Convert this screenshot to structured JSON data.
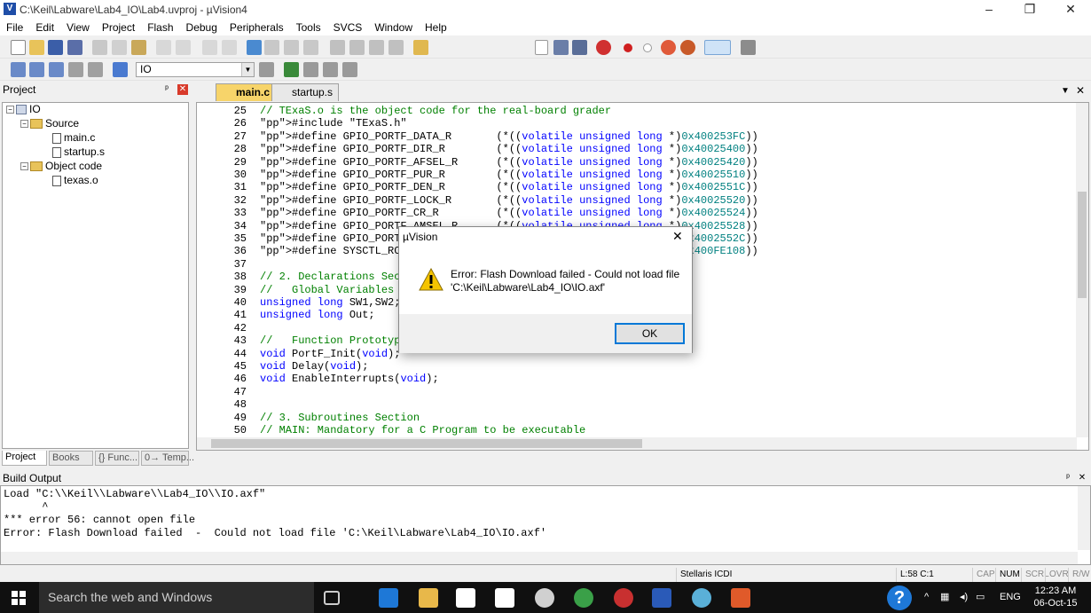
{
  "window": {
    "title": "C:\\Keil\\Labware\\Lab4_IO\\Lab4.uvproj - µVision4",
    "app_icon": "V",
    "minimize": "–",
    "restore": "❐",
    "close": "✕"
  },
  "menu": [
    "File",
    "Edit",
    "View",
    "Project",
    "Flash",
    "Debug",
    "Peripherals",
    "Tools",
    "SVCS",
    "Window",
    "Help"
  ],
  "toolbar2": {
    "target": "IO"
  },
  "project_panel": {
    "title": "Project",
    "pin": "ᵖ",
    "close": "✕",
    "tree": {
      "root": "IO",
      "groups": [
        {
          "name": "Source",
          "files": [
            "main.c",
            "startup.s"
          ]
        },
        {
          "name": "Object code",
          "files": [
            "texas.o"
          ]
        }
      ]
    },
    "tabs": [
      "Project",
      "Books",
      "{} Func...",
      "0→ Temp..."
    ]
  },
  "editor": {
    "tabs": [
      "main.c",
      "startup.s"
    ],
    "active_tab": "main.c",
    "lines": [
      {
        "n": "25",
        "t": "// TExaS.o is the object code for the real-board grader"
      },
      {
        "n": "26",
        "t": "#include \"TExaS.h\""
      },
      {
        "n": "27",
        "t": "#define GPIO_PORTF_DATA_R       (*((volatile unsigned long *)0x400253FC))"
      },
      {
        "n": "28",
        "t": "#define GPIO_PORTF_DIR_R        (*((volatile unsigned long *)0x40025400))"
      },
      {
        "n": "29",
        "t": "#define GPIO_PORTF_AFSEL_R      (*((volatile unsigned long *)0x40025420))"
      },
      {
        "n": "30",
        "t": "#define GPIO_PORTF_PUR_R        (*((volatile unsigned long *)0x40025510))"
      },
      {
        "n": "31",
        "t": "#define GPIO_PORTF_DEN_R        (*((volatile unsigned long *)0x4002551C))"
      },
      {
        "n": "32",
        "t": "#define GPIO_PORTF_LOCK_R       (*((volatile unsigned long *)0x40025520))"
      },
      {
        "n": "33",
        "t": "#define GPIO_PORTF_CR_R         (*((volatile unsigned long *)0x40025524))"
      },
      {
        "n": "34",
        "t": "#define GPIO_PORTF_AMSEL_R      (*((volatile unsigned long *)0x40025528))"
      },
      {
        "n": "35",
        "t": "#define GPIO_PORTF_PCTL_R       (*((volatile unsigned long *)0x4002552C))"
      },
      {
        "n": "36",
        "t": "#define SYSCTL_RCGC2_R          (*((volatile unsigned long *)0x400FE108))"
      },
      {
        "n": "37",
        "t": ""
      },
      {
        "n": "38",
        "t": "// 2. Declarations Section"
      },
      {
        "n": "39",
        "t": "//   Global Variables"
      },
      {
        "n": "40",
        "t": "unsigned long SW1,SW2;"
      },
      {
        "n": "41",
        "t": "unsigned long Out;"
      },
      {
        "n": "42",
        "t": ""
      },
      {
        "n": "43",
        "t": "//   Function Prototypes"
      },
      {
        "n": "44",
        "t": "void PortF_Init(void);"
      },
      {
        "n": "45",
        "t": "void Delay(void);"
      },
      {
        "n": "46",
        "t": "void EnableInterrupts(void);"
      },
      {
        "n": "47",
        "t": ""
      },
      {
        "n": "48",
        "t": ""
      },
      {
        "n": "49",
        "t": "// 3. Subroutines Section"
      },
      {
        "n": "50",
        "t": "// MAIN: Mandatory for a C Program to be executable"
      },
      {
        "n": "51",
        "t": "int main(void){"
      }
    ]
  },
  "dialog": {
    "title": "µVision",
    "close": "✕",
    "message_line1": "Error: Flash Download failed  -  Could not load file",
    "message_line2": "'C:\\Keil\\Labware\\Lab4_IO\\IO.axf'",
    "ok": "OK",
    "icon": "warning-icon"
  },
  "build_output": {
    "title": "Build Output",
    "lines": [
      "Load \"C:\\\\Keil\\\\Labware\\\\Lab4_IO\\\\IO.axf\"",
      "      ^",
      "*** error 56: cannot open file",
      "Error: Flash Download failed  -  Could not load file 'C:\\Keil\\Labware\\Lab4_IO\\IO.axf'"
    ]
  },
  "status": {
    "debugger": "Stellaris ICDI",
    "position": "L:58 C:1",
    "cap": "CAP",
    "num": "NUM",
    "scrl": "SCRL",
    "ovr": "OVR",
    "rw": "R/W"
  },
  "taskbar": {
    "search_placeholder": "Search the web and Windows",
    "lang": "ENG",
    "time": "12:23 AM",
    "date": "06-Oct-15",
    "help": "?"
  },
  "colors": {
    "keyword": "#0000ff",
    "comment": "#008000",
    "number": "#008080",
    "accent": "#0078d7"
  }
}
